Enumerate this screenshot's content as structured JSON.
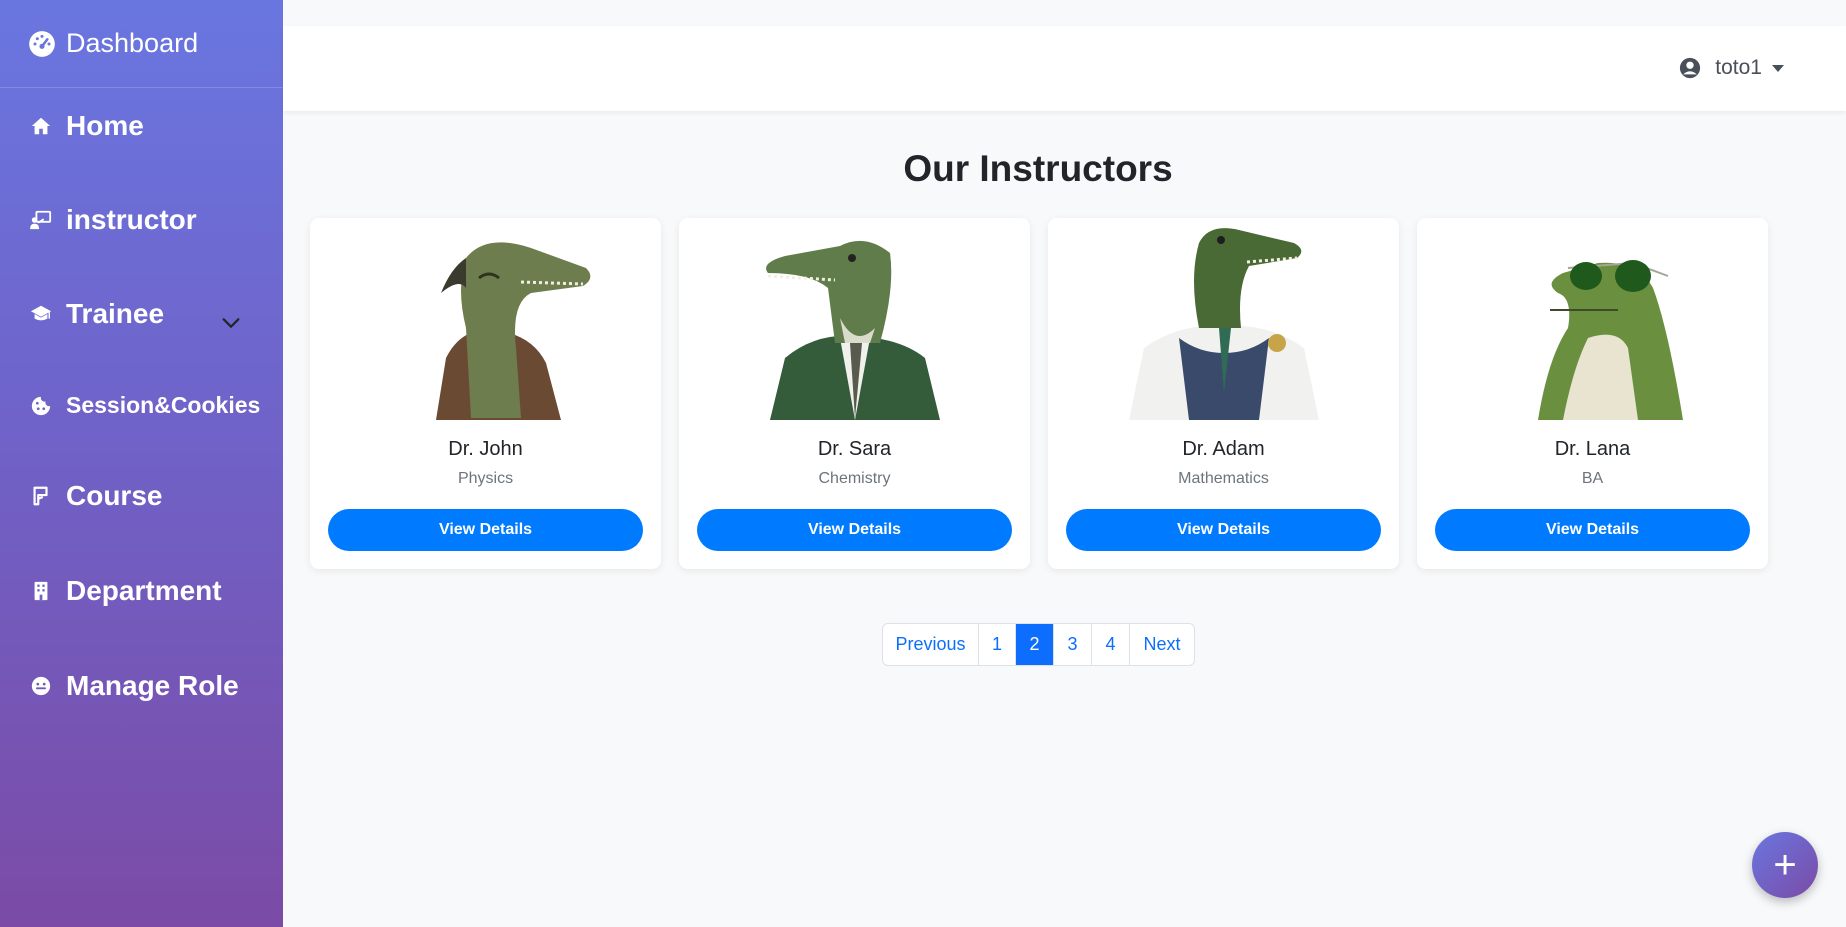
{
  "sidebar": {
    "brand": "Dashboard",
    "items": [
      {
        "label": "Home",
        "icon": "home-icon"
      },
      {
        "label": "instructor",
        "icon": "chalkboard-teacher-icon"
      },
      {
        "label": "Trainee",
        "icon": "graduation-cap-icon"
      },
      {
        "label": "Session&Cookies",
        "icon": "cookie-icon"
      },
      {
        "label": "Course",
        "icon": "course-icon"
      },
      {
        "label": "Department",
        "icon": "building-icon"
      },
      {
        "label": "Manage Role",
        "icon": "face-icon"
      }
    ]
  },
  "header": {
    "username": "toto1"
  },
  "main": {
    "title": "Our Instructors",
    "instructors": [
      {
        "name": "Dr. John",
        "subject": "Physics",
        "button": "View Details"
      },
      {
        "name": "Dr. Sara",
        "subject": "Chemistry",
        "button": "View Details"
      },
      {
        "name": "Dr. Adam",
        "subject": "Mathematics",
        "button": "View Details"
      },
      {
        "name": "Dr. Lana",
        "subject": "BA",
        "button": "View Details"
      }
    ]
  },
  "pagination": {
    "previous": "Previous",
    "pages": [
      "1",
      "2",
      "3",
      "4"
    ],
    "active": "2",
    "next": "Next"
  },
  "fab": {
    "label": "+"
  },
  "colors": {
    "primary": "#007bff",
    "sidebar_top": "#6a76e0",
    "sidebar_bottom": "#7b4ba6"
  }
}
